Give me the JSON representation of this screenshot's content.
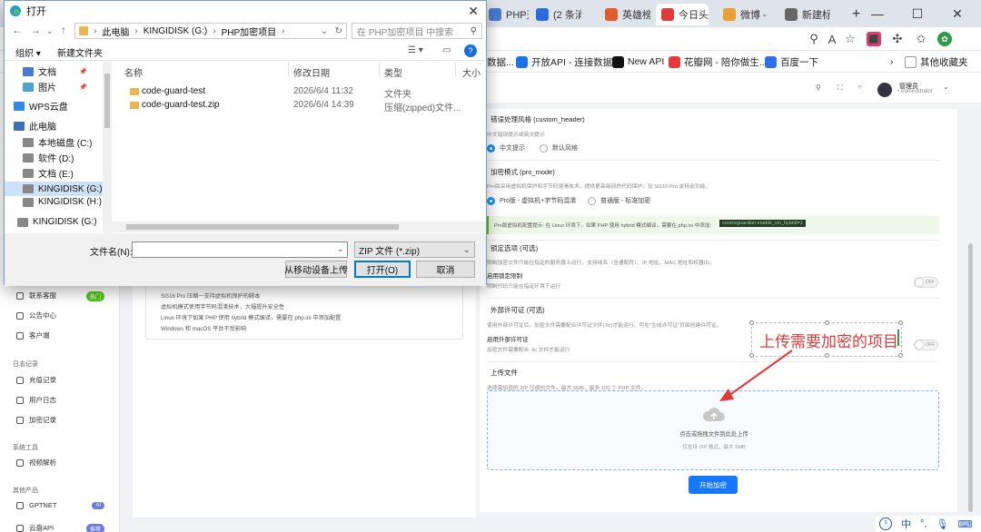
{
  "browser": {
    "tabs": [
      {
        "label": "PHP开",
        "color": "#4a7bd0",
        "active": false
      },
      {
        "label": "(2 条消",
        "color": "#2b6de0",
        "active": false
      },
      {
        "label": "英雄榜",
        "color": "#e25b2b",
        "active": false
      },
      {
        "label": "今日头",
        "color": "#e23b3b",
        "active": true
      },
      {
        "label": "微博 - ",
        "color": "#e9a030",
        "active": false
      },
      {
        "label": "新建标",
        "color": "#666666",
        "active": false
      }
    ],
    "new_tab": "+",
    "favorites": [
      {
        "label": "数据...",
        "color": "#ffffff"
      },
      {
        "label": "开放API - 连接数据...",
        "color": "#1a73e8"
      },
      {
        "label": "New API",
        "color": "#111111"
      },
      {
        "label": "花瓣网 - 陪你做生...",
        "color": "#e33c3c"
      },
      {
        "label": "百度一下",
        "color": "#2f6ee5"
      }
    ],
    "other_favorites": "其他收藏夹"
  },
  "app": {
    "header": {
      "user_name": "管理员",
      "user_role": "• Administrator"
    },
    "sidebar": {
      "items_a": [
        {
          "label": "联系客服",
          "badge": "热门",
          "badge_color": "#52c41a"
        },
        {
          "label": "公告中心",
          "badge": "",
          "badge_color": ""
        },
        {
          "label": "客户端",
          "badge": "",
          "badge_color": ""
        }
      ],
      "section_log": "日志记录",
      "items_b": [
        {
          "label": "充值记录"
        },
        {
          "label": "用户日志"
        },
        {
          "label": "加密记录"
        }
      ],
      "section_tools": "系统工具",
      "items_c": [
        {
          "label": "视频解析"
        }
      ],
      "section_other": "其他产品",
      "items_d": [
        {
          "label": "GPTNET",
          "badge": "AI",
          "badge_color": "#6c7ae0"
        },
        {
          "label": "云盘API",
          "badge": "推荐",
          "badge_color": "#6c7ae0"
        }
      ]
    },
    "info_lines": [
      "SG16 Pro 压缩一支持虚拟机保护的脚本",
      "虚拟机模式使用字节码混淆技术，大幅提升安全性",
      "Linux 环境下如果 PHP 使用 hybrid 模式编译，需要在 php.ini 中添加配置",
      "Windows 和 macOS 平台不受影响"
    ],
    "config": {
      "error_title": "错误处理风格 (custom_header)",
      "error_desc": "中文错误提示或英文提示",
      "error_options": [
        "中文提示",
        "默认风格"
      ],
      "pro_title": "加密模式 (pro_mode)",
      "pro_desc": "Pro版采用虚拟机保护和字节码混淆技术，提供更高级别的代码保护。仅 SG16 Pro 支持此功能。",
      "pro_options": [
        "Pro版 - 虚拟机+字节码混淆",
        "普通版 - 标准加密"
      ],
      "pro_note": "Pro版虚拟机配置提示: 在 Linux 环境下，如果 PHP 使用 hybrid 模式编译，需要在 php.ini 中添加:",
      "pro_note_code": "sourceguardian.enable_vm_hybrid=1",
      "lock_title": "锁定选项 (可选)",
      "lock_desc": "限制加密文件只能在指定的服务器上运行，支持域名（含通配符）、IP 地址、MAC 地址和机器ID。",
      "lock_enable": "启用锁定限制",
      "lock_enable_desc": "限制代码只能在指定环境下运行",
      "license_title": "外部许可证 (可选)",
      "license_desc": "使用外部许可证后，加密文件需要配合许可证文件(.lic)才能运行。可在\"生成许可证\"页面创建许可证。",
      "license_enable": "启用外部许可证",
      "license_enable_desc": "加密文件需要配合 .lic 文件才能运行",
      "toggle_off": "OFF",
      "upload_title": "上传文件",
      "upload_desc": "选择需加密的 ZIP 压缩包文件，最大 5MB，最多 100 个 PHP 文件。",
      "drop_text": "点击或拖拽文件到此处上传",
      "drop_hint": "仅支持 ZIP 格式，最大 5MB",
      "start_button": "开始加密"
    },
    "annotation": "上传需要加密的项目"
  },
  "dialog": {
    "title": "打开",
    "address": [
      "此电脑",
      "KINGIDISK (G:)",
      "PHP加密项目"
    ],
    "search_placeholder": "在 PHP加密项目 中搜索",
    "cmd_organize": "组织 ▾",
    "cmd_new_folder": "新建文件夹",
    "tree": [
      {
        "label": "文档",
        "pin": "📌",
        "color": "#4a7bd0",
        "selected": false
      },
      {
        "label": "图片",
        "pin": "📌",
        "color": "#4aa3d0",
        "selected": false
      },
      {
        "label": "WPS云盘",
        "pin": "",
        "color": "#2f8be6",
        "selected": false
      },
      {
        "label": "此电脑",
        "pin": "",
        "color": "#3d6fb5",
        "selected": false
      },
      {
        "label": "本地磁盘 (C:)",
        "pin": "",
        "color": "#888888",
        "selected": false
      },
      {
        "label": "软件 (D:)",
        "pin": "",
        "color": "#888888",
        "selected": false
      },
      {
        "label": "文档 (E:)",
        "pin": "",
        "color": "#888888",
        "selected": false
      },
      {
        "label": "KINGIDISK (G:)",
        "pin": "",
        "color": "#888888",
        "selected": true
      },
      {
        "label": "KINGIDISK (H:)",
        "pin": "",
        "color": "#888888",
        "selected": false
      },
      {
        "label": "KINGIDISK (G:)",
        "pin": "",
        "color": "#888888",
        "selected": false
      }
    ],
    "columns": [
      "名称",
      "修改日期",
      "类型",
      "大小"
    ],
    "files": [
      {
        "name": "code-guard-test",
        "date": "2026/6/4 11:32",
        "type": "文件夹",
        "color": "#e8b64a"
      },
      {
        "name": "code-guard-test.zip",
        "date": "2026/6/4 14:39",
        "type": "压缩(zipped)文件...",
        "color": "#e8b64a"
      }
    ],
    "filename_label": "文件名(N):",
    "filename_value": "",
    "filetype_value": "ZIP 文件 (*.zip)",
    "btn_mobile": "从移动设备上传",
    "btn_open": "打开(O)",
    "btn_cancel": "取消"
  },
  "ime": {
    "lang": "中",
    "punct": "°,"
  }
}
